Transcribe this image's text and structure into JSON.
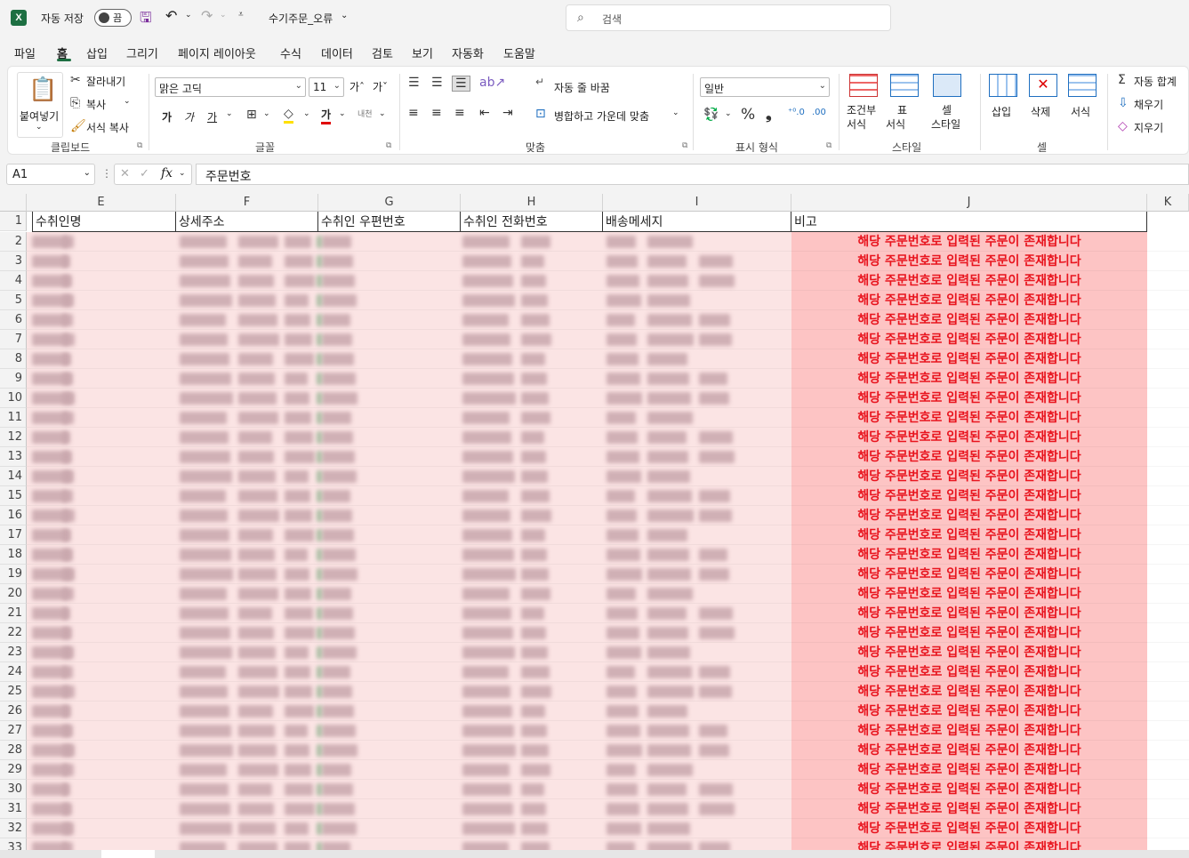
{
  "titlebar": {
    "app_icon": "X",
    "autosave_label": "자동 저장",
    "autosave_state": "끔",
    "file_name": "수기주문_오류",
    "search_placeholder": "검색"
  },
  "tabs": [
    "파일",
    "홈",
    "삽입",
    "그리기",
    "페이지 레이아웃",
    "수식",
    "데이터",
    "검토",
    "보기",
    "자동화",
    "도움말"
  ],
  "active_tab": "홈",
  "ribbon": {
    "clipboard": {
      "paste": "붙여넣기",
      "cut": "잘라내기",
      "copy": "복사",
      "format_painter": "서식 복사",
      "group": "클립보드"
    },
    "font": {
      "name": "맑은 고딕",
      "size": "11",
      "bold": "가",
      "italic": "가",
      "underline": "가",
      "group": "글꼴"
    },
    "alignment": {
      "wrap": "자동 줄 바꿈",
      "merge": "병합하고 가운데 맞춤",
      "group": "맞춤"
    },
    "number": {
      "format": "일반",
      "group": "표시 형식"
    },
    "styles": {
      "conditional_1": "조건부",
      "conditional_2": "서식",
      "table_1": "표",
      "table_2": "서식",
      "cell_1": "셀",
      "cell_2": "스타일",
      "group": "스타일"
    },
    "cells": {
      "insert": "삽입",
      "delete": "삭제",
      "format": "서식",
      "group": "셀"
    },
    "editing": {
      "autosum": "자동 합계",
      "fill": "채우기",
      "clear": "지우기"
    }
  },
  "formula_bar": {
    "name_box": "A1",
    "fx": "fx",
    "value": "주문번호"
  },
  "columns": [
    "E",
    "F",
    "G",
    "H",
    "I",
    "J",
    "K"
  ],
  "headers": [
    "수취인명",
    "상세주소",
    "수취인 우편번호",
    "수취인 전화번호",
    "배송메세지",
    "비고"
  ],
  "rows": [
    "1",
    "2",
    "3",
    "4",
    "5",
    "6",
    "7",
    "8",
    "9",
    "10",
    "11",
    "12",
    "13",
    "14",
    "15",
    "16",
    "17",
    "18",
    "19",
    "20",
    "21",
    "22",
    "23",
    "24",
    "25",
    "26",
    "27",
    "28",
    "29",
    "30",
    "31",
    "32",
    "33"
  ],
  "error_message": "해당 주문번호로 입력된 주문이 존재합니다",
  "colors": {
    "accent": "#1d6f42",
    "error_text": "#e8141e",
    "error_fill": "#fdc4c4",
    "row_fill": "#fbe4e4"
  }
}
